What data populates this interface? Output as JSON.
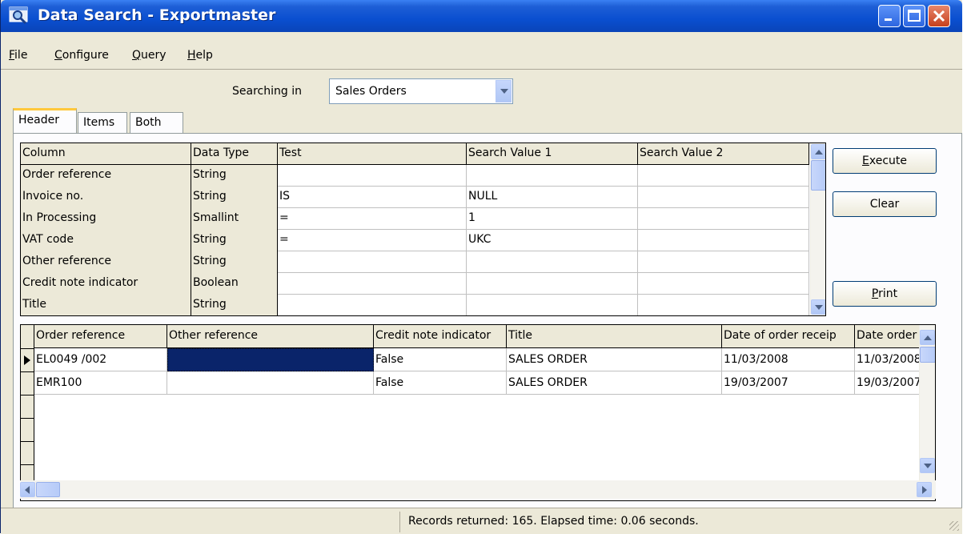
{
  "window": {
    "title": "Data Search - Exportmaster"
  },
  "menu": {
    "file": "ile",
    "configure": "onfigure",
    "query": "uery",
    "help": "elp"
  },
  "menu_accel": {
    "file": "F",
    "configure": "C",
    "query": "Q",
    "help": "H"
  },
  "search": {
    "label": "Searching in",
    "value": "Sales Orders"
  },
  "tabs": [
    {
      "label": "Header"
    },
    {
      "label": "Items"
    },
    {
      "label": "Both"
    }
  ],
  "criteria": {
    "headers": [
      "Column",
      "Data Type",
      "Test",
      "Search Value 1",
      "Search Value 2"
    ],
    "rows": [
      {
        "column": "Order reference",
        "type": "String",
        "test": "",
        "v1": "",
        "v2": ""
      },
      {
        "column": "Invoice no.",
        "type": "String",
        "test": "IS",
        "v1": "NULL",
        "v2": ""
      },
      {
        "column": "In Processing",
        "type": "Smallint",
        "test": "=",
        "v1": "1",
        "v2": ""
      },
      {
        "column": "VAT code",
        "type": "String",
        "test": "=",
        "v1": "UKC",
        "v2": ""
      },
      {
        "column": "Other reference",
        "type": "String",
        "test": "",
        "v1": "",
        "v2": ""
      },
      {
        "column": "Credit note indicator",
        "type": "Boolean",
        "test": "",
        "v1": "",
        "v2": ""
      },
      {
        "column": "Title",
        "type": "String",
        "test": "",
        "v1": "",
        "v2": ""
      }
    ]
  },
  "buttons": {
    "execute_rest": "xecute",
    "execute_accel": "E",
    "clear": "Clear",
    "print_rest": "rint",
    "print_accel": "P"
  },
  "results": {
    "headers": [
      "Order reference",
      "Other reference",
      "Credit note indicator",
      "Title",
      "Date of order receip",
      "Date order r"
    ],
    "rows": [
      {
        "order_ref": "EL0049    /002",
        "other_ref": "",
        "credit": "False",
        "title": "SALES ORDER",
        "date_receipt": "11/03/2008",
        "date_order": "11/03/2008"
      },
      {
        "order_ref": "EMR100",
        "other_ref": "",
        "credit": "False",
        "title": "SALES ORDER",
        "date_receipt": "19/03/2007",
        "date_order": "19/03/2007"
      }
    ]
  },
  "status": {
    "text": "Records returned: 165.  Elapsed time: 0.06 seconds."
  }
}
